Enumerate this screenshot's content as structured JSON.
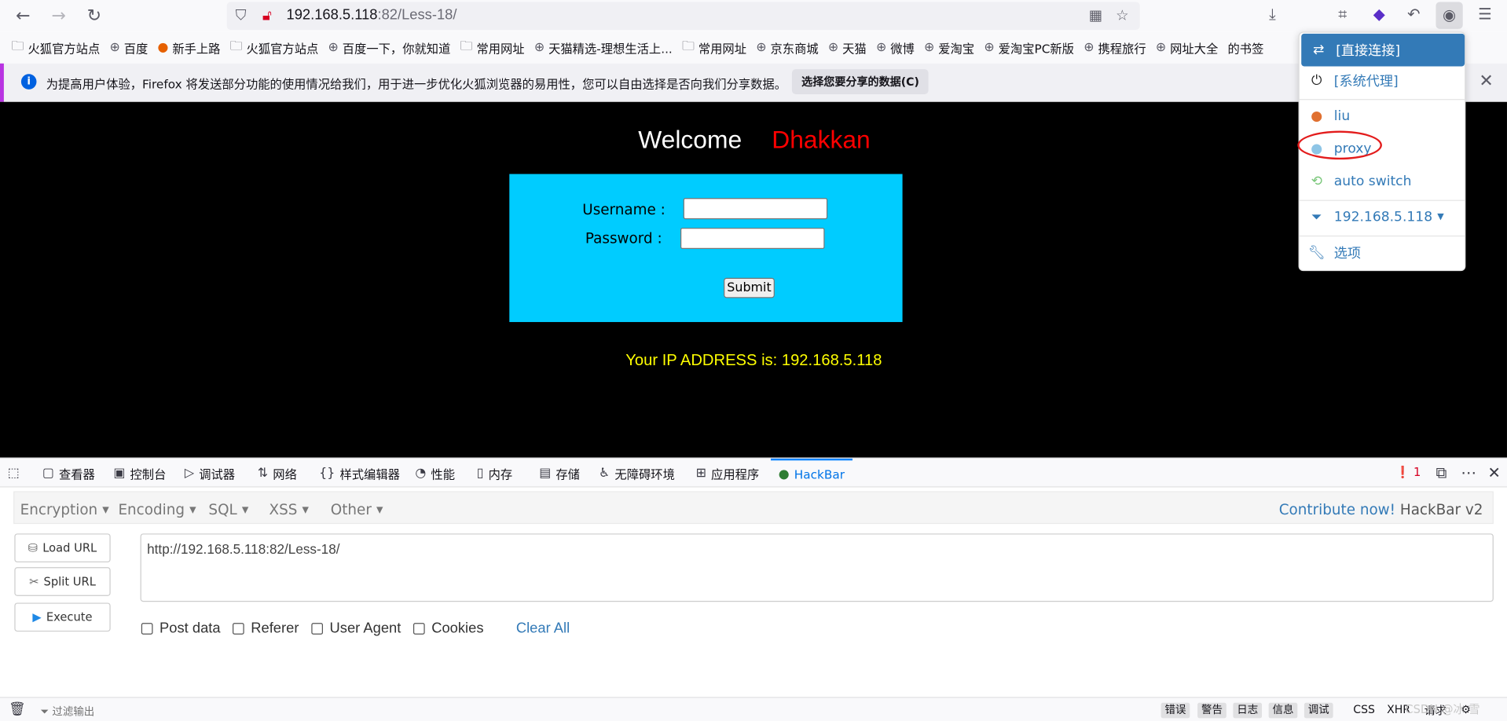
{
  "browser": {
    "url_host": "192.168.5.118",
    "url_rest": ":82/Less-18/",
    "bookmarks": [
      "火狐官方站点",
      "百度",
      "新手上路",
      "火狐官方站点",
      "百度一下，你就知道",
      "常用网址",
      "天猫精选-理想生活上...",
      "常用网址",
      "京东商城",
      "天猫",
      "微博",
      "爱淘宝",
      "爱淘宝PC新版",
      "携程旅行",
      "网址大全",
      "的书签"
    ],
    "notification": {
      "message": "为提高用户体验，Firefox 将发送部分功能的使用情况给我们，用于进一步优化火狐浏览器的易用性，您可以自由选择是否向我们分享数据。",
      "button": "选择您要分享的数据(C)"
    }
  },
  "page": {
    "welcome": "Welcome",
    "name": "Dhakkan",
    "username_label": "Username :",
    "password_label": "Password :",
    "submit_label": "Submit",
    "ip_text": "Your IP ADDRESS is: 192.168.5.118"
  },
  "devtools": {
    "tabs": [
      "查看器",
      "控制台",
      "调试器",
      "网络",
      "样式编辑器",
      "性能",
      "内存",
      "存储",
      "无障碍环境",
      "应用程序",
      "HackBar"
    ],
    "error_count": "1"
  },
  "hackbar": {
    "menu": [
      "Encryption",
      "Encoding",
      "SQL",
      "XSS",
      "Other"
    ],
    "contribute_link": "Contribute now!",
    "version": "HackBar v2",
    "load_url": "Load URL",
    "split_url": "Split URL",
    "execute": "Execute",
    "url_value": "http://192.168.5.118:82/Less-18/",
    "checks": [
      "Post data",
      "Referer",
      "User Agent",
      "Cookies"
    ],
    "clear_all": "Clear All"
  },
  "console": {
    "filter_placeholder": "过滤输出",
    "buttons": [
      "错误",
      "警告",
      "日志",
      "信息",
      "调试"
    ],
    "types": [
      "CSS",
      "XHR",
      "请求"
    ],
    "watermark": "CSDN @冰 雪"
  },
  "proxy_menu": {
    "items": [
      "[直接连接]",
      "[系统代理]",
      "liu",
      "proxy",
      "auto switch",
      "192.168.5.118",
      "选项"
    ]
  }
}
